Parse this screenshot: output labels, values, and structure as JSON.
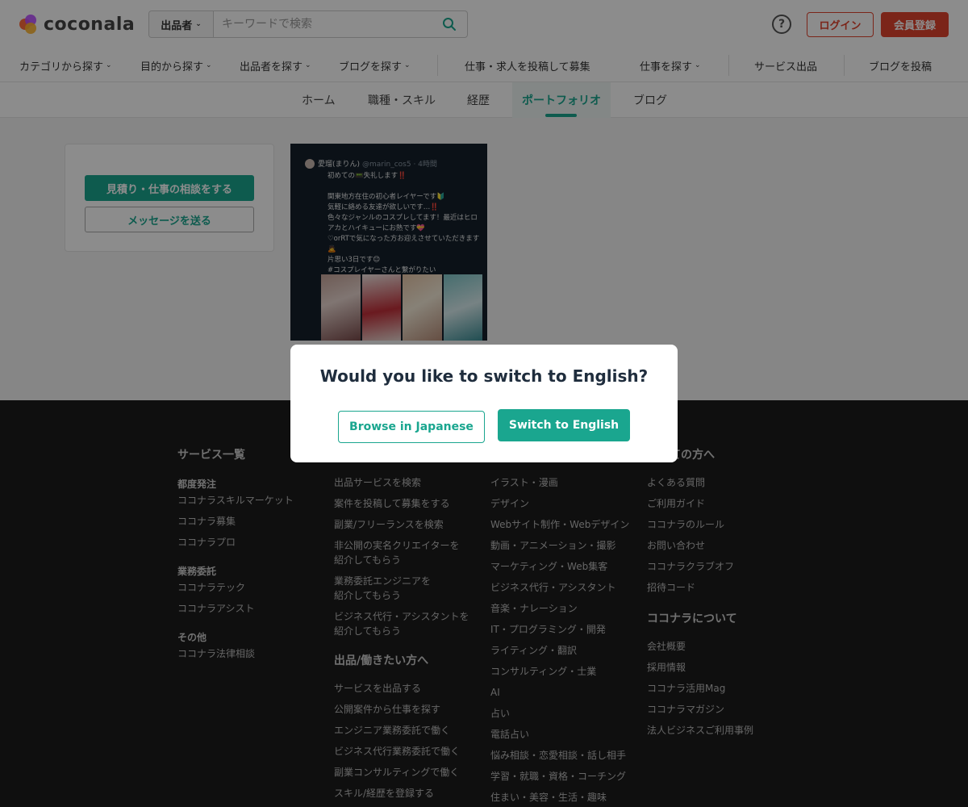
{
  "header": {
    "logo_text": "coconala",
    "search_type": "出品者",
    "search_placeholder": "キーワードで検索",
    "help_label": "?",
    "login_label": "ログイン",
    "signup_label": "会員登録"
  },
  "gnav": {
    "items": [
      "カテゴリから探す",
      "目的から探す",
      "出品者を探す",
      "ブログを探す",
      "仕事・求人を投稿して募集",
      "仕事を探す",
      "サービス出品",
      "ブログを投稿"
    ]
  },
  "profile_tabs": [
    "ホーム",
    "職種・スキル",
    "経歴",
    "ポートフォリオ",
    "ブログ"
  ],
  "side": {
    "consult_label": "見積り・仕事の相談をする",
    "message_label": "メッセージを送る"
  },
  "portfolio": {
    "tweet_name": "愛瑠(まりん)",
    "tweet_handle": "@marin_cos5 · 4時間",
    "tweet_body": "初めての📟失礼します‼️\n\n関東地方在住の初心者レイヤーです🔰\n気軽に絡める友達が欲しいです…‼️\n色々なジャンルのコスプレしてます！最近はヒロアカとハイキューにお熱です💝\n♡orRTで気になった方お迎えさせていただきます🙇\n片思い3日です😊\n#コスプレイヤーさんと繋がりたい"
  },
  "footer": {
    "col1": {
      "heading": "サービス一覧",
      "g1_title": "都度発注",
      "g1_links": [
        "ココナラスキルマーケット",
        "ココナラ募集",
        "ココナラプロ"
      ],
      "g2_title": "業務委託",
      "g2_links": [
        "ココナラテック",
        "ココナラアシスト"
      ],
      "g3_title": "その他",
      "g3_links": [
        "ココナラ法律相談"
      ]
    },
    "col2": {
      "links_a": [
        "出品サービスを検索",
        "案件を投稿して募集をする",
        "副業/フリーランスを検索"
      ],
      "link_b1": "非公開の実名クリエイターを",
      "link_b2": "紹介してもらう",
      "link_c1": "業務委託エンジニアを",
      "link_c2": "紹介してもらう",
      "link_d1": "ビジネス代行・アシスタントを",
      "link_d2": "紹介してもらう",
      "heading2": "出品/働きたい方へ",
      "links_e": [
        "サービスを出品する",
        "公開案件から仕事を探す",
        "エンジニア業務委託で働く",
        "ビジネス代行業務委託で働く",
        "副業コンサルティングで働く",
        "スキル/経歴を登録する"
      ]
    },
    "col3": {
      "links": [
        "イラスト・漫画",
        "デザイン",
        "Webサイト制作・Webデザイン",
        "動画・アニメーション・撮影",
        "マーケティング・Web集客",
        "ビジネス代行・アシスタント",
        "音楽・ナレーション",
        "IT・プログラミング・開発",
        "ライティング・翻訳",
        "コンサルティング・士業",
        "AI",
        "占い",
        "電話占い",
        "悩み相談・恋愛相談・話し相手",
        "学習・就職・資格・コーチング",
        "住まい・美容・生活・趣味"
      ]
    },
    "col4": {
      "heading": "初めての方へ",
      "links": [
        "よくある質問",
        "ご利用ガイド",
        "ココナラのルール",
        "お問い合わせ",
        "ココナラクラブオフ",
        "招待コード"
      ],
      "heading2": "ココナラについて",
      "links2": [
        "会社概要",
        "採用情報",
        "ココナラ活用Mag",
        "ココナラマガジン",
        "法人ビジネスご利用事例"
      ]
    }
  },
  "modal": {
    "title": "Would you like to switch to English?",
    "jp_label": "Browse in Japanese",
    "en_label": "Switch to English"
  },
  "colors": {
    "accent": "#1aa68f",
    "brand_red": "#e0442e",
    "footer_bg": "#1c1c1c"
  }
}
